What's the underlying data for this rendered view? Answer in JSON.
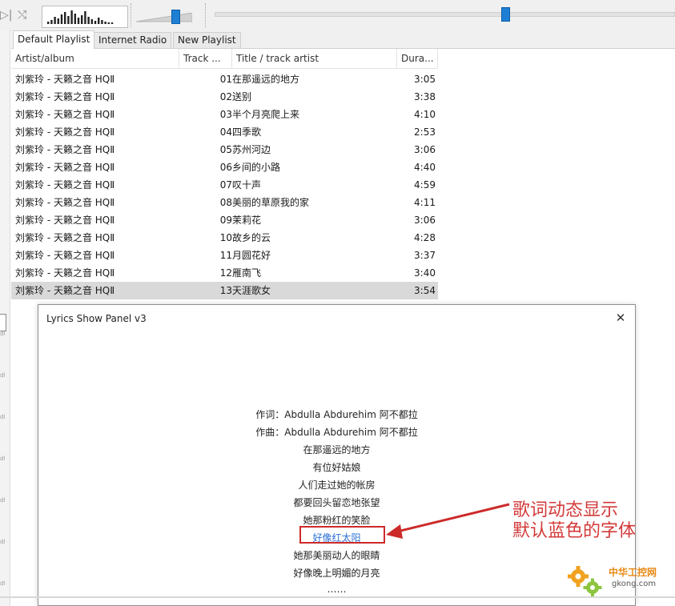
{
  "toolbar": {
    "icons": [
      "play-pause-icon",
      "random-icon"
    ],
    "volume_percent": 70,
    "seek_percent": 63
  },
  "tabs": [
    {
      "label": "Default Playlist",
      "active": true
    },
    {
      "label": "Internet Radio",
      "active": false
    },
    {
      "label": "New Playlist",
      "active": false
    }
  ],
  "playlist": {
    "columns": {
      "artist": "Artist/album",
      "track": "Track ...",
      "title": "Title / track artist",
      "duration": "Dura..."
    },
    "rows": [
      {
        "artist": "刘紫玲 - 天籁之音 HQⅡ",
        "track": "01",
        "title": "在那遥远的地方",
        "duration": "3:05"
      },
      {
        "artist": "刘紫玲 - 天籁之音 HQⅡ",
        "track": "02",
        "title": "送别",
        "duration": "3:38"
      },
      {
        "artist": "刘紫玲 - 天籁之音 HQⅡ",
        "track": "03",
        "title": "半个月亮爬上来",
        "duration": "4:10"
      },
      {
        "artist": "刘紫玲 - 天籁之音 HQⅡ",
        "track": "04",
        "title": "四季歌",
        "duration": "2:53"
      },
      {
        "artist": "刘紫玲 - 天籁之音 HQⅡ",
        "track": "05",
        "title": "苏州河边",
        "duration": "3:06"
      },
      {
        "artist": "刘紫玲 - 天籁之音 HQⅡ",
        "track": "06",
        "title": "乡间的小路",
        "duration": "4:40"
      },
      {
        "artist": "刘紫玲 - 天籁之音 HQⅡ",
        "track": "07",
        "title": "叹十声",
        "duration": "4:59"
      },
      {
        "artist": "刘紫玲 - 天籁之音 HQⅡ",
        "track": "08",
        "title": "美丽的草原我的家",
        "duration": "4:11"
      },
      {
        "artist": "刘紫玲 - 天籁之音 HQⅡ",
        "track": "09",
        "title": "茉莉花",
        "duration": "3:06"
      },
      {
        "artist": "刘紫玲 - 天籁之音 HQⅡ",
        "track": "10",
        "title": "故乡的云",
        "duration": "4:28"
      },
      {
        "artist": "刘紫玲 - 天籁之音 HQⅡ",
        "track": "11",
        "title": "月圆花好",
        "duration": "3:37"
      },
      {
        "artist": "刘紫玲 - 天籁之音 HQⅡ",
        "track": "12",
        "title": "雁南飞",
        "duration": "3:40"
      },
      {
        "artist": "刘紫玲 - 天籁之音 HQⅡ",
        "track": "13",
        "title": "天涯歌女",
        "duration": "3:54",
        "selected": true
      }
    ]
  },
  "lyrics_panel": {
    "title": "Lyrics Show Panel v3",
    "close_glyph": "✕",
    "current_index": 7,
    "lines": [
      "作词：Abdulla Abdurehim 阿不都拉",
      "作曲：Abdulla Abdurehim 阿不都拉",
      "在那遥远的地方",
      "有位好姑娘",
      "人们走过她的帐房",
      "都要回头留恋地张望",
      "她那粉红的笑脸",
      "好像红太阳",
      "她那美丽动人的眼睛",
      "好像晚上明媚的月亮",
      "……"
    ],
    "current_color": "#2a6fd6"
  },
  "annotation": {
    "line1": "歌词动态显示",
    "line2": "默认蓝色的字体",
    "color": "#d33a3a"
  },
  "watermark": {
    "name": "中华工控网",
    "url": "gkong.com"
  }
}
